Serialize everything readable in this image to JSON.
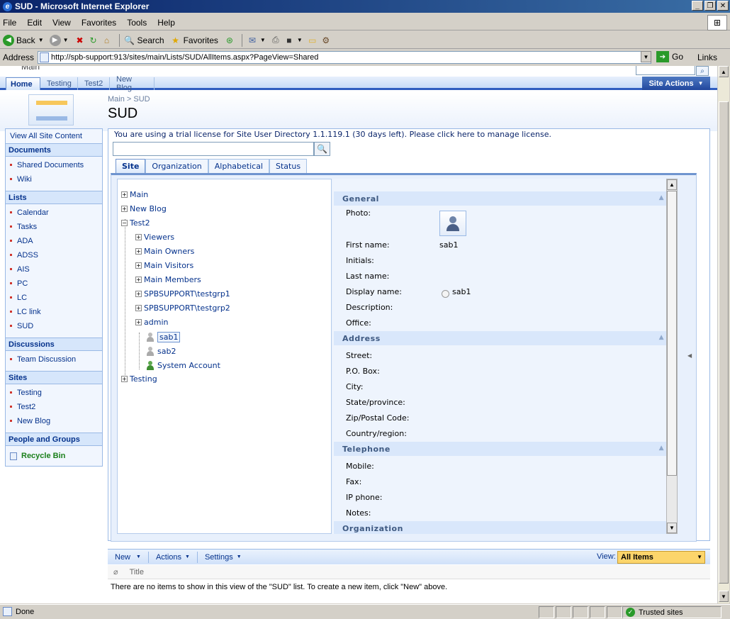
{
  "window": {
    "title": "SUD - Microsoft Internet Explorer"
  },
  "menu": {
    "file": "File",
    "edit": "Edit",
    "view": "View",
    "favorites": "Favorites",
    "tools": "Tools",
    "help": "Help"
  },
  "toolbar": {
    "back": "Back",
    "search": "Search",
    "favorites": "Favorites"
  },
  "address": {
    "label": "Address",
    "url": "http://spb-support:913/sites/main/Lists/SUD/AllItems.aspx?PageView=Shared",
    "go": "Go",
    "links": "Links"
  },
  "sp": {
    "site_title": "Main",
    "tabs": [
      "Home",
      "Testing",
      "Test2",
      "New Blog"
    ],
    "site_actions": "Site Actions",
    "breadcrumb": "Main > SUD",
    "page_title": "SUD"
  },
  "leftnav": {
    "view_all": "View All Site Content",
    "documents": {
      "header": "Documents",
      "items": [
        "Shared Documents",
        "Wiki"
      ]
    },
    "lists": {
      "header": "Lists",
      "items": [
        "Calendar",
        "Tasks",
        "ADA",
        "ADSS",
        "AIS",
        "PC",
        "LC",
        "LC link",
        "SUD"
      ]
    },
    "discussions": {
      "header": "Discussions",
      "items": [
        "Team Discussion"
      ]
    },
    "sites": {
      "header": "Sites",
      "items": [
        "Testing",
        "Test2",
        "New Blog"
      ]
    },
    "people": "People and Groups",
    "recycle": "Recycle Bin"
  },
  "ud": {
    "trial_msg": "You are using a trial license for Site User Directory 1.1.119.1 (30 days left). Please click here to manage license.",
    "tabs": [
      "Site",
      "Organization",
      "Alphabetical",
      "Status"
    ],
    "tree": {
      "main": "Main",
      "newblog": "New Blog",
      "test2": "Test2",
      "viewers": "Viewers",
      "owners": "Main Owners",
      "visitors": "Main Visitors",
      "members": "Main Members",
      "grp1": "SPBSUPPORT\\testgrp1",
      "grp2": "SPBSUPPORT\\testgrp2",
      "admin": "admin",
      "sab1": "sab1",
      "sab2": "sab2",
      "system": "System Account",
      "testing": "Testing"
    },
    "details": {
      "general": "General",
      "photo": "Photo:",
      "first_name": "First name:",
      "first_name_val": "sab1",
      "initials": "Initials:",
      "last_name": "Last name:",
      "display_name": "Display name:",
      "display_name_val": "sab1",
      "description": "Description:",
      "office": "Office:",
      "address": "Address",
      "street": "Street:",
      "pobox": "P.O. Box:",
      "city": "City:",
      "state": "State/province:",
      "zip": "Zip/Postal Code:",
      "country": "Country/region:",
      "telephone": "Telephone",
      "mobile": "Mobile:",
      "fax": "Fax:",
      "ipphone": "IP phone:",
      "notes": "Notes:",
      "organization": "Organization"
    }
  },
  "list": {
    "new": "New",
    "actions": "Actions",
    "settings": "Settings",
    "view_label": "View:",
    "view_value": "All Items",
    "col_title": "Title",
    "empty_msg": "There are no items to show in this view of the \"SUD\" list. To create a new item, click \"New\" above."
  },
  "status": {
    "done": "Done",
    "zone": "Trusted sites"
  }
}
